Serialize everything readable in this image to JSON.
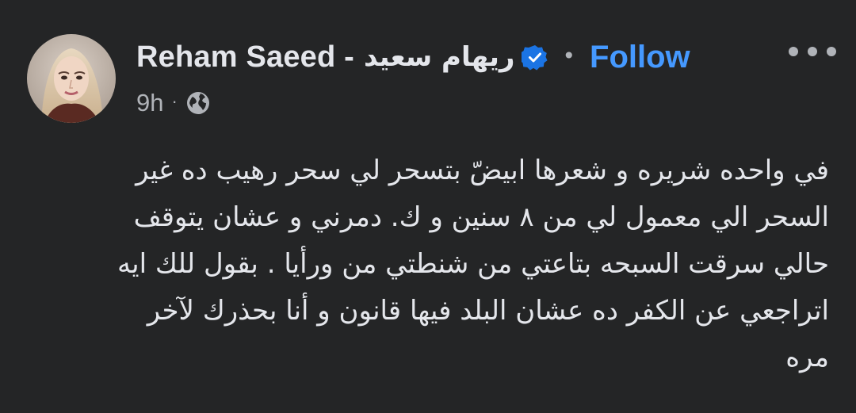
{
  "post": {
    "author_name": "Reham Saeed -",
    "author_name_ar": "ريهام سعيد",
    "separator": "•",
    "follow_label": "Follow",
    "time": "9h",
    "meta_separator": "·",
    "audience_icon": "globe-icon",
    "verified_icon": "verified-badge-icon",
    "more_icon": "more-options-icon",
    "body_lines": [
      "في واحده شريره و شعرها ابيضّ بتسحر لي سحر رهيب ده غير",
      "السحر الي معمول لي من ٨ سنين و ك. دمرني و عشان يتوقف",
      "حالي سرقت السبحه بتاعتي من شنطتي من ورأيا . بقول للك ايه",
      "اتراجعي عن الكفر ده عشان البلد فيها قانون و أنا بحذرك لآخر",
      "مره"
    ]
  },
  "colors": {
    "background": "#242526",
    "text_primary": "#e4e6eb",
    "text_secondary": "#b0b3b8",
    "follow_blue": "#4599ff",
    "verified_blue": "#1b74e4"
  }
}
